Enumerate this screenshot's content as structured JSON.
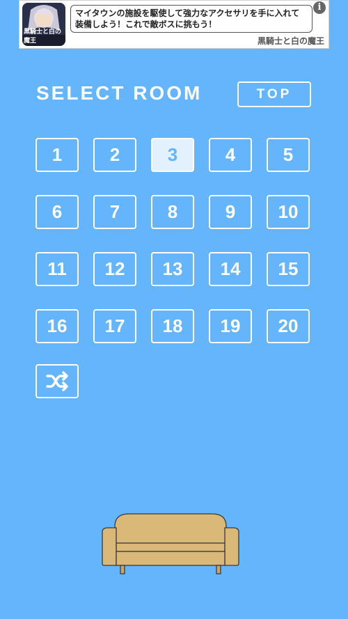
{
  "ad": {
    "text": "マイタウンの施設を駆使して強力なアクセサリを手に入れて装備しよう！これで敵ボスに挑もう！",
    "source": "黒騎士と白の魔王",
    "info_icon": "info-icon",
    "thumb_caption": "黒騎士と白の魔王"
  },
  "header": {
    "title": "SELECT ROOM",
    "top_label": "TOP"
  },
  "rooms": [
    "1",
    "2",
    "3",
    "4",
    "5",
    "6",
    "7",
    "8",
    "9",
    "10",
    "11",
    "12",
    "13",
    "14",
    "15",
    "16",
    "17",
    "18",
    "19",
    "20"
  ],
  "selected_room": "3",
  "shuffle_icon": "shuffle-icon",
  "decoration": {
    "sofa_icon": "sofa-icon"
  },
  "colors": {
    "background": "#64b5fc",
    "selected_fill": "#e3f1fe",
    "outline": "#ffffff",
    "sofa": "#d9b878"
  }
}
